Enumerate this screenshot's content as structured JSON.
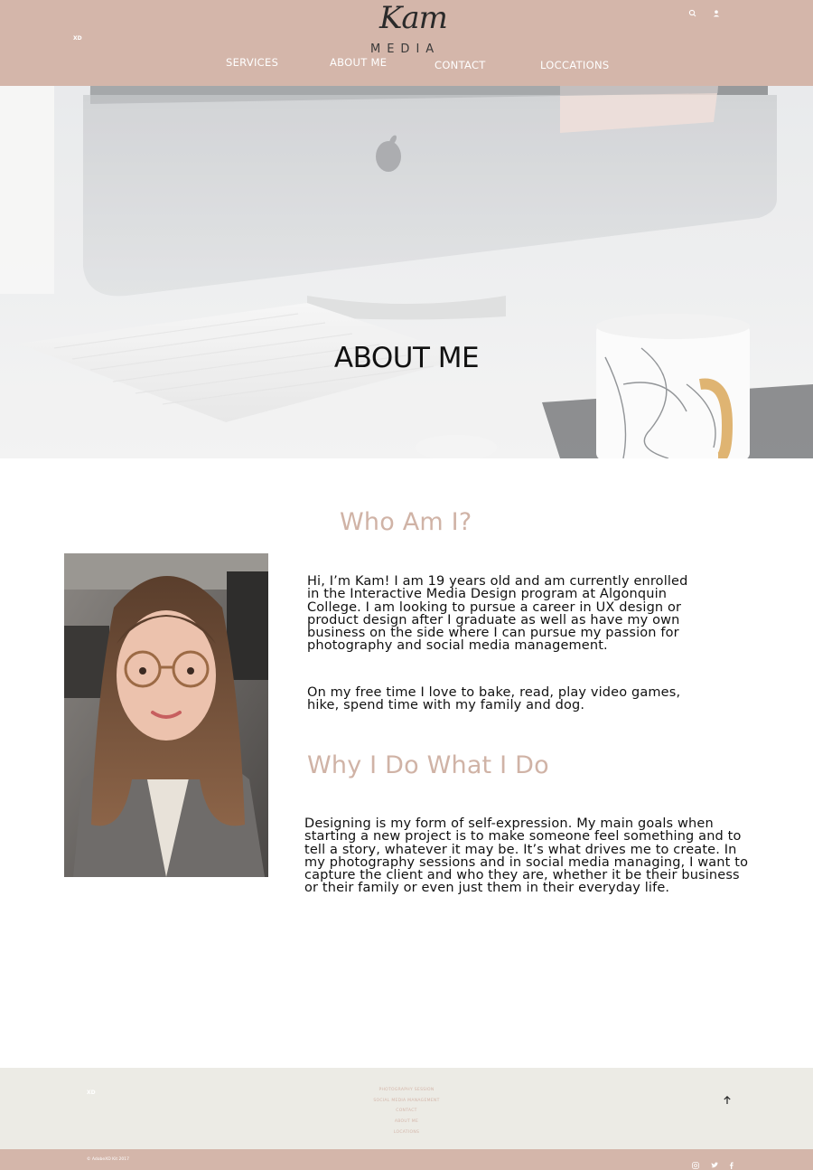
{
  "header": {
    "xd_tag": "XD",
    "logo": {
      "script": "Kam",
      "wordmark": "MEDIA"
    },
    "icons": [
      "search-icon",
      "user-icon"
    ],
    "nav": [
      {
        "label": "SERVICES"
      },
      {
        "label": "ABOUT ME"
      },
      {
        "label": "CONTACT"
      },
      {
        "label": "LOCCATIONS"
      }
    ]
  },
  "hero": {
    "title": "ABOUT ME"
  },
  "about": {
    "heading": "Who Am I?",
    "intro_lines": [
      "Hi, I’m Kam! I am 19 years old and am currently enrolled",
      "in the Interactive Media Design program at Algonquin",
      "College. I am looking to pursue a career in UX design or",
      "product design after I graduate as well as have my own",
      "business on the side where I can pursue my passion for",
      "photography and social media management."
    ],
    "free_time_lines": [
      "On my free time I love to bake, read, play video games,",
      "hike, spend time with my family and dog."
    ]
  },
  "why": {
    "heading": "Why I Do What I Do",
    "lines": [
      "Designing is my form of self-expression. My main goals when",
      "starting a new project is to make someone feel something and to",
      "tell a story, whatever it may be. It’s what drives me to create. In",
      "my photography sessions and in social media managing, I want to",
      "capture the client and who they are, whether it be their business",
      "or their family or even just them in their everyday life."
    ]
  },
  "footer": {
    "xd_tag": "XD",
    "links": [
      {
        "label": "PHOTOGRAPHY SESSION"
      },
      {
        "label": "SOCIAL MEDIA MANAGEMENT"
      },
      {
        "label": "CONTACT"
      },
      {
        "label": "ABOUT ME"
      },
      {
        "label": "LOCATIONS"
      }
    ],
    "to_top_icon": "arrow-up-icon",
    "copyright": "© AdobeXD Kit 2017",
    "social_icons": [
      "instagram-icon",
      "twitter-icon",
      "facebook-icon"
    ]
  },
  "colors": {
    "brand": "#d4b6aa",
    "heading_accent": "#d0b3a6",
    "footer_bg": "#ecebe5",
    "text": "#111111"
  }
}
